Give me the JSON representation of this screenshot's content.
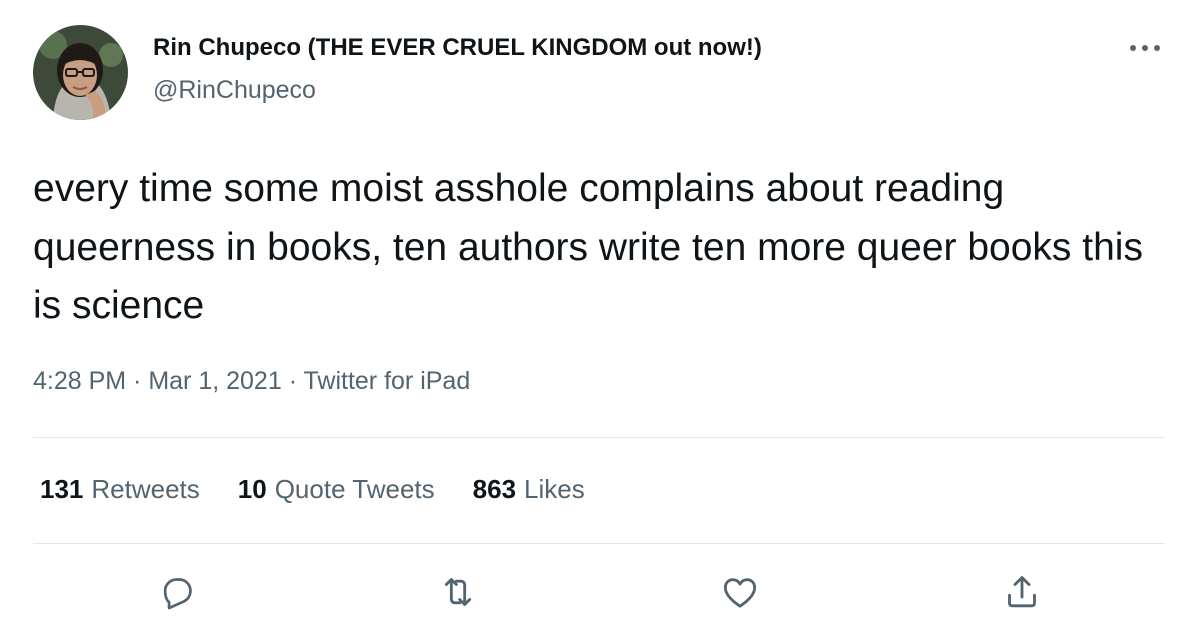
{
  "author": {
    "display_name": "Rin Chupeco (THE EVER CRUEL KINGDOM out now!)",
    "handle": "@RinChupeco",
    "avatar_icon": "user-avatar"
  },
  "tweet": {
    "text": "every time some moist asshole complains about reading queerness in books, ten authors write ten more queer books this is science",
    "time": "4:28 PM",
    "date": "Mar 1, 2021",
    "source": "Twitter for iPad",
    "separator": " · "
  },
  "stats": {
    "retweets_count": "131",
    "retweets_label": "Retweets",
    "quotes_count": "10",
    "quotes_label": "Quote Tweets",
    "likes_count": "863",
    "likes_label": "Likes"
  },
  "actions": [
    {
      "icon": "reply-icon"
    },
    {
      "icon": "retweet-icon"
    },
    {
      "icon": "like-icon"
    },
    {
      "icon": "share-icon"
    }
  ],
  "colors": {
    "text_primary": "#0f1419",
    "text_secondary": "#536471",
    "divider": "#e1e6ea",
    "background": "#ffffff"
  }
}
